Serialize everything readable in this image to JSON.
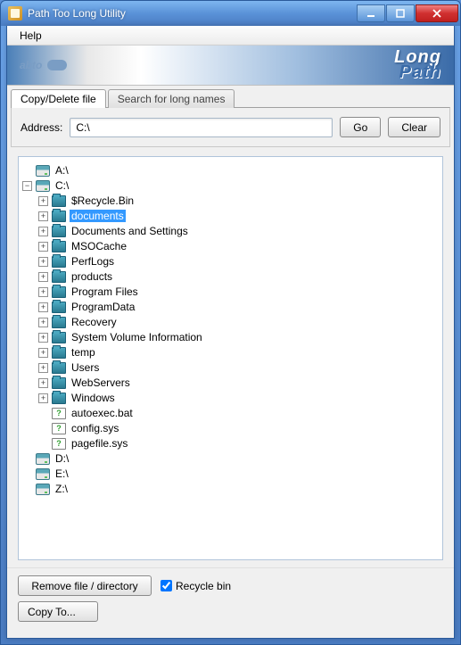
{
  "window": {
    "title": "Path Too Long Utility"
  },
  "menubar": {
    "help": "Help"
  },
  "banner": {
    "brand": "abto",
    "line1": "Long",
    "line2": "Path"
  },
  "tabs": {
    "copy_delete": "Copy/Delete file",
    "search_long": "Search for long names"
  },
  "address": {
    "label": "Address:",
    "value": "C:\\",
    "go": "Go",
    "clear": "Clear"
  },
  "tree": {
    "drives": {
      "a": "A:\\",
      "c": "C:\\",
      "d": "D:\\",
      "e": "E:\\",
      "z": "Z:\\"
    },
    "c_children": {
      "recycle": "$Recycle.Bin",
      "documents": "documents",
      "docsettings": "Documents and Settings",
      "msocache": "MSOCache",
      "perflogs": "PerfLogs",
      "products": "products",
      "programfiles": "Program Files",
      "programdata": "ProgramData",
      "recovery": "Recovery",
      "svi": "System Volume Information",
      "temp": "temp",
      "users": "Users",
      "webservers": "WebServers",
      "windows": "Windows",
      "autoexec": "autoexec.bat",
      "configsys": "config.sys",
      "pagefile": "pagefile.sys"
    }
  },
  "actions": {
    "remove": "Remove file / directory",
    "recycle_bin": "Recycle bin",
    "copy_to": "Copy To..."
  }
}
